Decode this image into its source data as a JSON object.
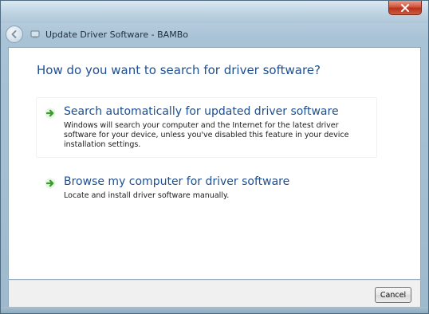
{
  "window": {
    "title": "Update Driver Software - BAMBo",
    "close_icon": "close-icon"
  },
  "nav": {
    "back_icon": "back-arrow-icon",
    "wizard_icon": "device-icon"
  },
  "main": {
    "heading": "How do you want to search for driver software?",
    "options": [
      {
        "icon": "green-arrow-icon",
        "title": "Search automatically for updated driver software",
        "description": "Windows will search your computer and the Internet for the latest driver software for your device, unless you've disabled this feature in your device installation settings."
      },
      {
        "icon": "green-arrow-icon",
        "title": "Browse my computer for driver software",
        "description": "Locate and install driver software manually."
      }
    ]
  },
  "footer": {
    "cancel_label": "Cancel"
  },
  "colors": {
    "link_blue": "#1d4f91",
    "arrow_green": "#3a9a2a",
    "close_red": "#c8432a"
  }
}
